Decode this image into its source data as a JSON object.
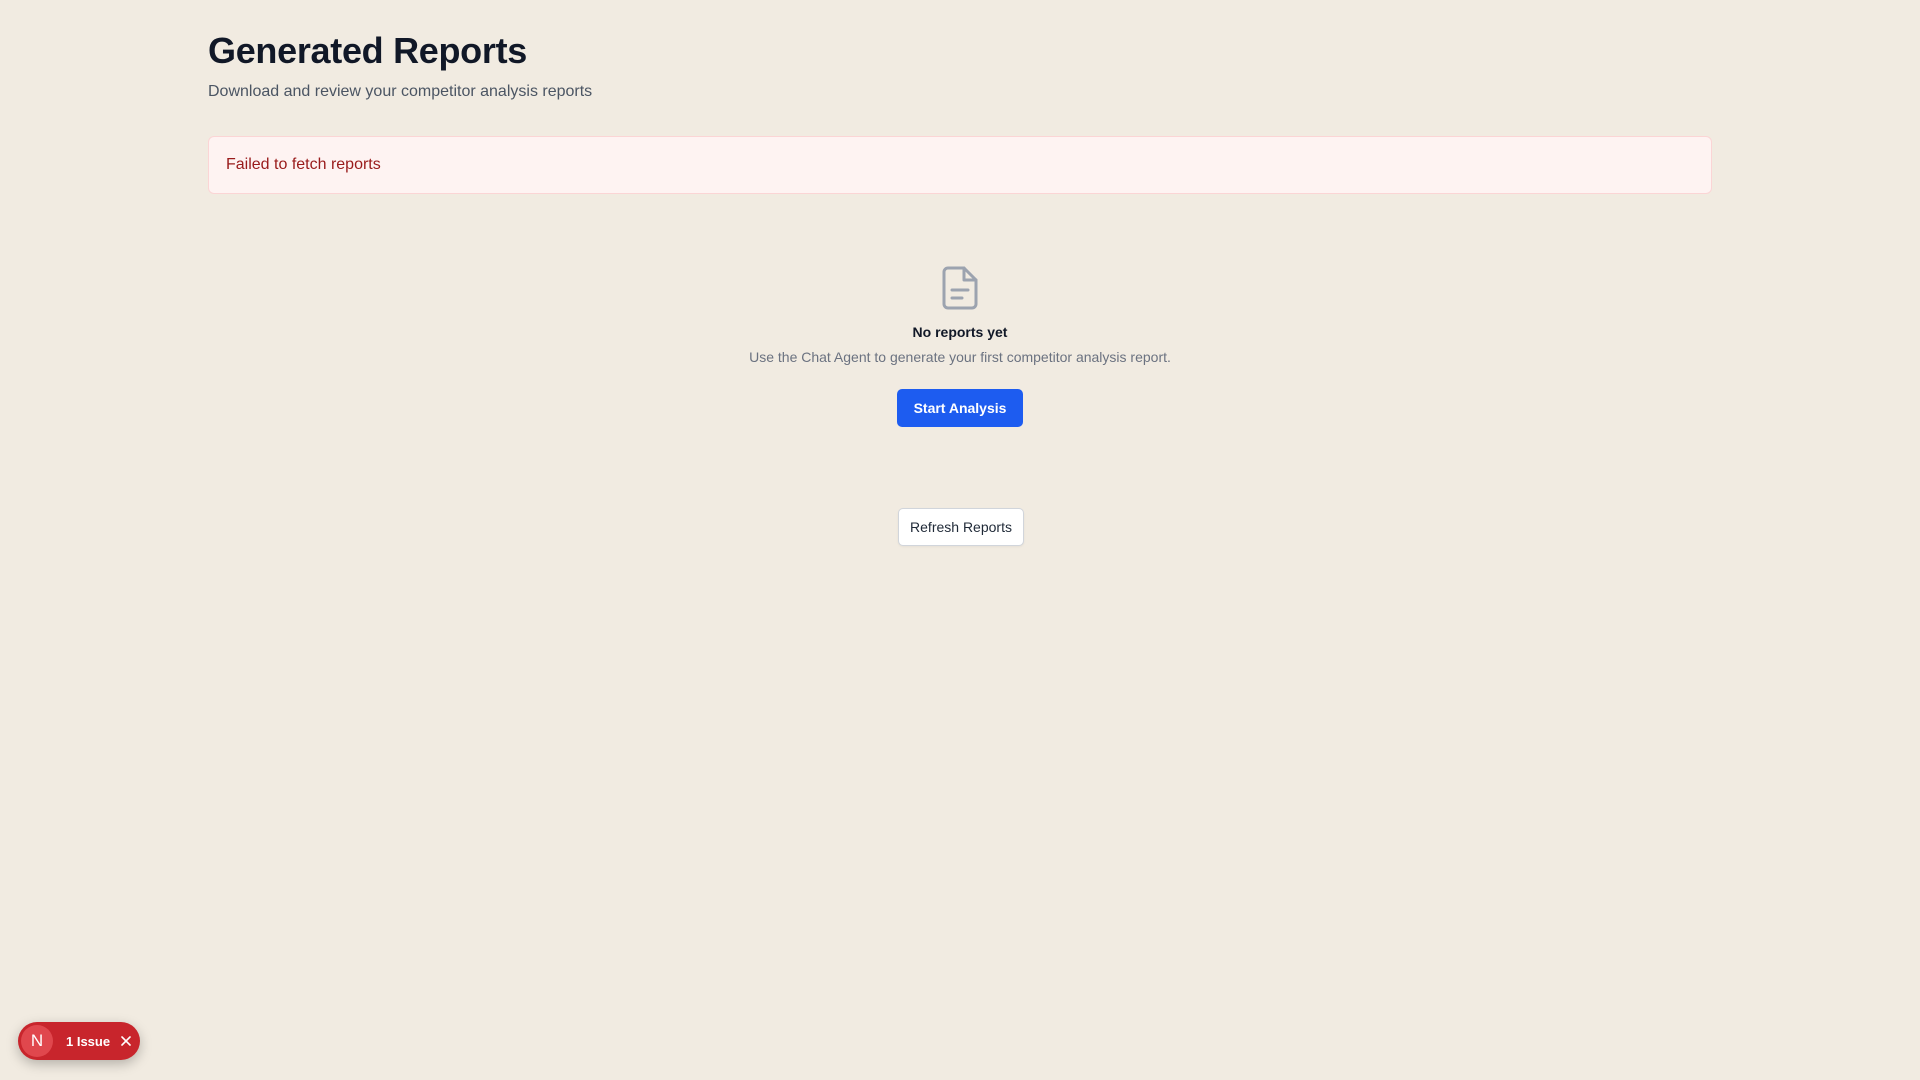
{
  "header": {
    "title": "Generated Reports",
    "subtitle": "Download and review your competitor analysis reports"
  },
  "alert": {
    "message": "Failed to fetch reports"
  },
  "empty_state": {
    "icon": "document-icon",
    "title": "No reports yet",
    "description": "Use the Chat Agent to generate your first competitor analysis report.",
    "action_label": "Start Analysis"
  },
  "refresh": {
    "label": "Refresh Reports"
  },
  "dev_overlay": {
    "logo_letter": "N",
    "issues_label": "1 Issue"
  },
  "colors": {
    "background": "#f1ebe1",
    "primary": "#1d5cf0",
    "error_text": "#991b1b",
    "error_bg": "#fef3f2",
    "issue_badge": "#c8252c"
  }
}
